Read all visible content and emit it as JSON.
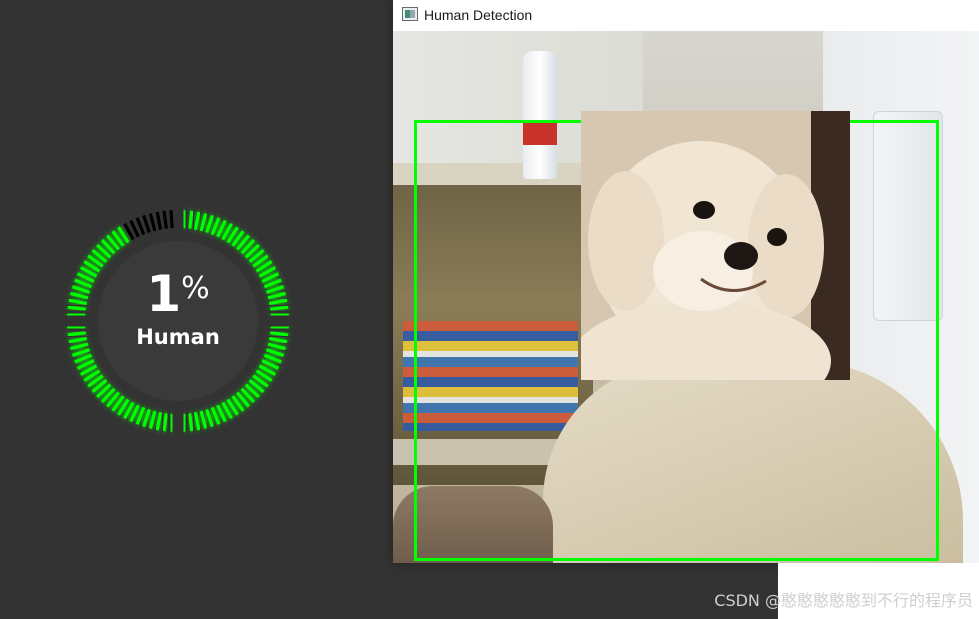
{
  "gauge": {
    "value": "1",
    "unit": "%",
    "label": "Human",
    "fraction": 0.92,
    "colors": {
      "active": "#00ff00",
      "inactive": "#000000",
      "background": "#333333"
    }
  },
  "window": {
    "title": "Human Detection",
    "icon": "app-window-icon",
    "detection_box_color": "#00ff00"
  },
  "watermark": {
    "text": "CSDN @憨憨憨憨憨到不行的程序员"
  }
}
